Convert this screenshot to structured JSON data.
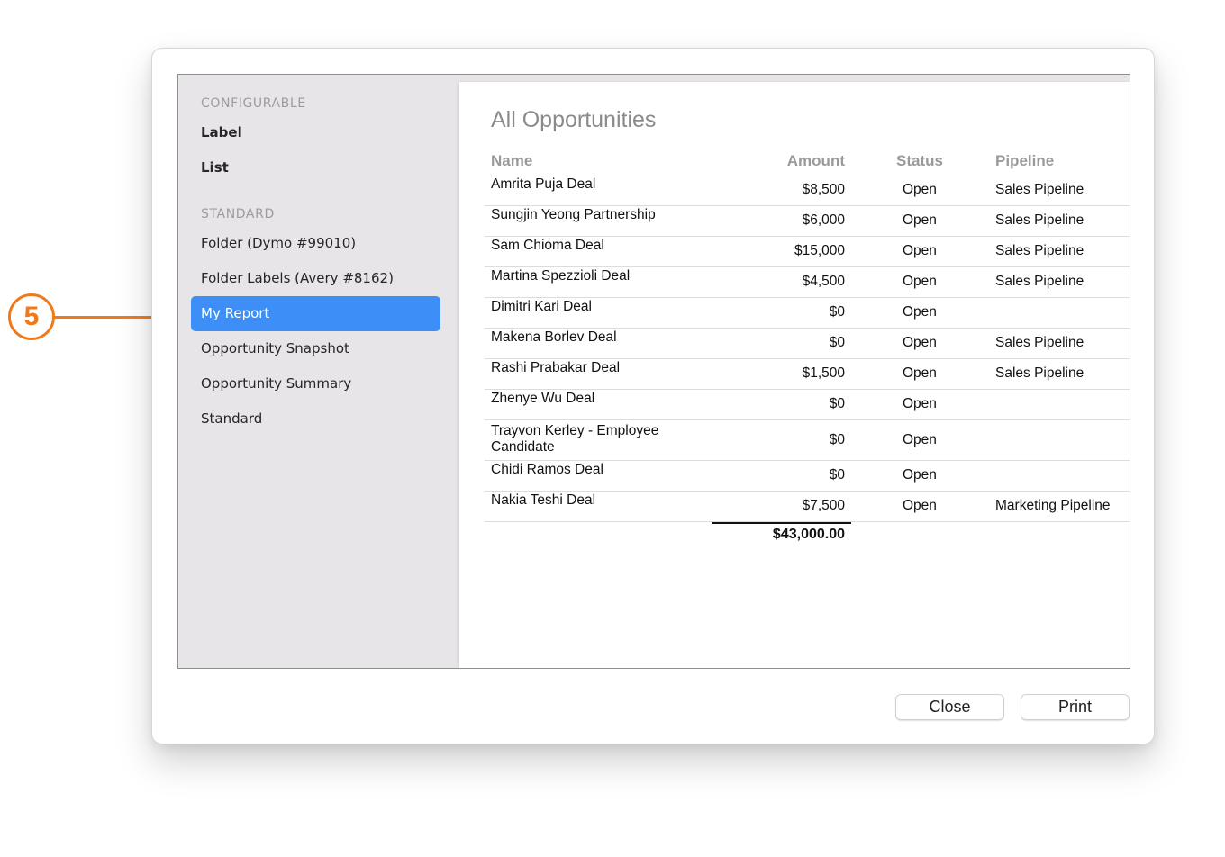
{
  "callout": {
    "number": "5"
  },
  "sidebar": {
    "configurable_header": "CONFIGURABLE",
    "configurable_items": [
      {
        "label": "Label"
      },
      {
        "label": "List"
      }
    ],
    "standard_header": "STANDARD",
    "standard_items": [
      {
        "label": "Folder (Dymo #99010)"
      },
      {
        "label": "Folder Labels (Avery #8162)"
      },
      {
        "label": "My Report",
        "selected": true
      },
      {
        "label": "Opportunity Snapshot"
      },
      {
        "label": "Opportunity Summary"
      },
      {
        "label": "Standard"
      }
    ]
  },
  "report": {
    "title": "All Opportunities",
    "columns": {
      "name": "Name",
      "amount": "Amount",
      "status": "Status",
      "pipeline": "Pipeline"
    },
    "rows": [
      {
        "name": "Amrita Puja Deal",
        "amount": "$8,500",
        "status": "Open",
        "pipeline": "Sales Pipeline"
      },
      {
        "name": "Sungjin Yeong Partnership",
        "amount": "$6,000",
        "status": "Open",
        "pipeline": "Sales Pipeline"
      },
      {
        "name": "Sam Chioma Deal",
        "amount": "$15,000",
        "status": "Open",
        "pipeline": "Sales Pipeline"
      },
      {
        "name": "Martina Spezzioli Deal",
        "amount": "$4,500",
        "status": "Open",
        "pipeline": "Sales Pipeline"
      },
      {
        "name": "Dimitri Kari Deal",
        "amount": "$0",
        "status": "Open",
        "pipeline": ""
      },
      {
        "name": "Makena Borlev Deal",
        "amount": "$0",
        "status": "Open",
        "pipeline": "Sales Pipeline"
      },
      {
        "name": "Rashi Prabakar Deal",
        "amount": "$1,500",
        "status": "Open",
        "pipeline": "Sales Pipeline"
      },
      {
        "name": "Zhenye Wu Deal",
        "amount": "$0",
        "status": "Open",
        "pipeline": ""
      },
      {
        "name": "Trayvon Kerley - Employee Candidate",
        "amount": "$0",
        "status": "Open",
        "pipeline": ""
      },
      {
        "name": "Chidi Ramos Deal",
        "amount": "$0",
        "status": "Open",
        "pipeline": ""
      },
      {
        "name": "Nakia Teshi Deal",
        "amount": "$7,500",
        "status": "Open",
        "pipeline": "Marketing Pipeline"
      }
    ],
    "total": "$43,000.00"
  },
  "buttons": {
    "close": "Close",
    "print": "Print"
  },
  "colors": {
    "selection": "#3d8ff7",
    "callout": "#f07a1a"
  }
}
